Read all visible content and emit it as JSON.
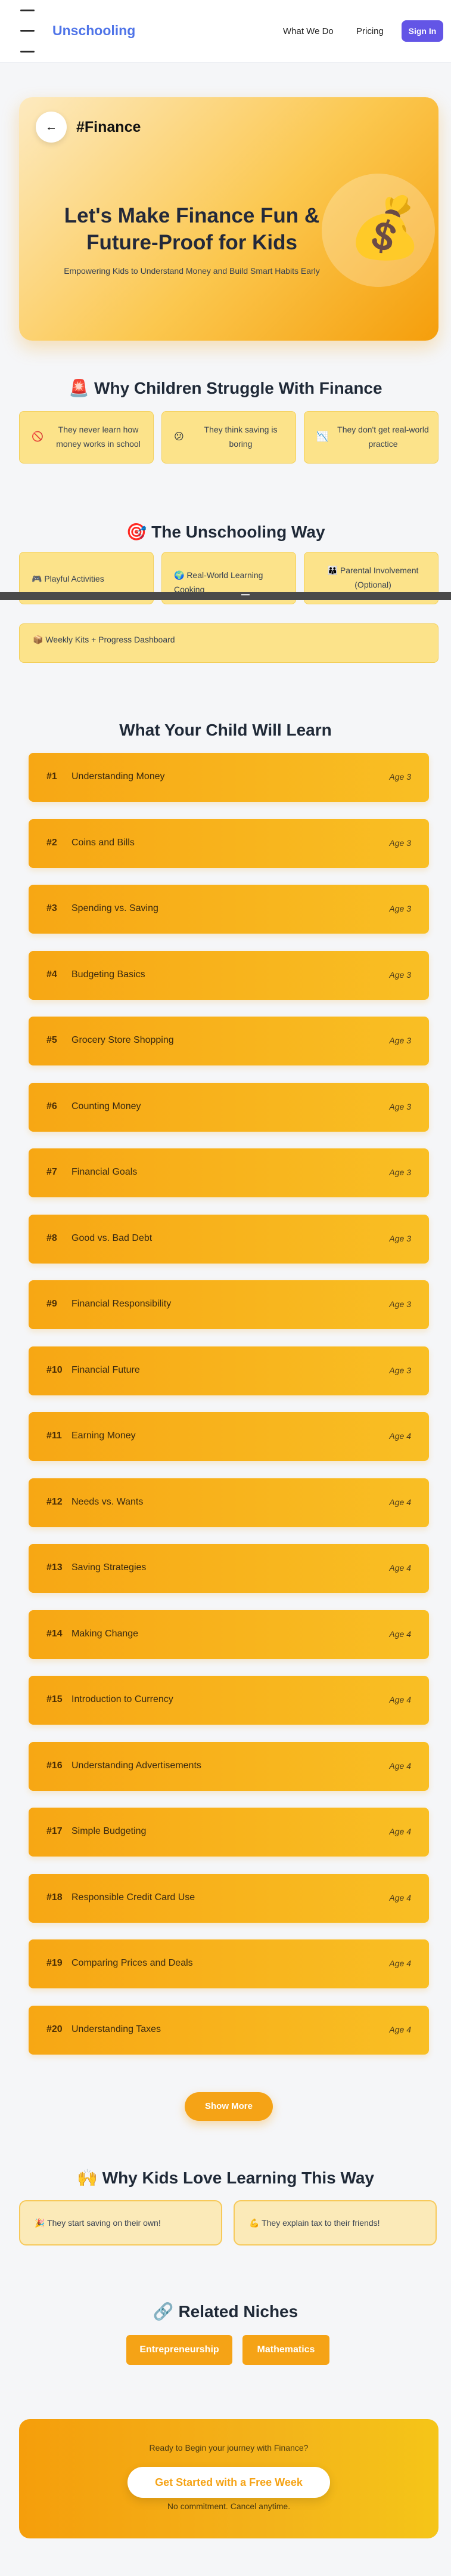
{
  "header": {
    "brand": "Unschooling",
    "nav": [
      "What We Do",
      "Pricing"
    ],
    "signin_label": "Sign In"
  },
  "hero": {
    "back_icon": "←",
    "hashtag": "#Finance",
    "title": "Let's Make Finance Fun & Future-Proof for Kids",
    "subtitle": "Empowering Kids to Understand Money and Build Smart Habits Early",
    "emoji": "💰"
  },
  "struggle": {
    "icon": "🚨",
    "title": "Why Children Struggle With Finance",
    "cards": [
      {
        "icon": "🚫",
        "text": "They never learn how money works in school"
      },
      {
        "icon": "😕",
        "text": "They think saving is boring"
      },
      {
        "icon": "📉",
        "text": "They don't get real-world practice"
      }
    ]
  },
  "way": {
    "icon": "🎯",
    "title": "The Unschooling Way",
    "cards": [
      {
        "text": "🎮 Playful Activities"
      },
      {
        "text": "🌍 Real-World Learning Cooking"
      },
      {
        "text": "👪 Parental Involvement (Optional)"
      },
      {
        "text": "📦 Weekly Kits + Progress Dashboard"
      }
    ]
  },
  "learn": {
    "title": "What Your Child Will Learn",
    "items": [
      {
        "num": "#1",
        "name": "Understanding Money",
        "age": "Age 3"
      },
      {
        "num": "#2",
        "name": "Coins and Bills",
        "age": "Age 3"
      },
      {
        "num": "#3",
        "name": "Spending vs. Saving",
        "age": "Age 3"
      },
      {
        "num": "#4",
        "name": "Budgeting Basics",
        "age": "Age 3"
      },
      {
        "num": "#5",
        "name": "Grocery Store Shopping",
        "age": "Age 3"
      },
      {
        "num": "#6",
        "name": "Counting Money",
        "age": "Age 3"
      },
      {
        "num": "#7",
        "name": "Financial Goals",
        "age": "Age 3"
      },
      {
        "num": "#8",
        "name": "Good vs. Bad Debt",
        "age": "Age 3"
      },
      {
        "num": "#9",
        "name": "Financial Responsibility",
        "age": "Age 3"
      },
      {
        "num": "#10",
        "name": "Financial Future",
        "age": "Age 3"
      },
      {
        "num": "#11",
        "name": "Earning Money",
        "age": "Age 4"
      },
      {
        "num": "#12",
        "name": "Needs vs. Wants",
        "age": "Age 4"
      },
      {
        "num": "#13",
        "name": "Saving Strategies",
        "age": "Age 4"
      },
      {
        "num": "#14",
        "name": "Making Change",
        "age": "Age 4"
      },
      {
        "num": "#15",
        "name": "Introduction to Currency",
        "age": "Age 4"
      },
      {
        "num": "#16",
        "name": "Understanding Advertisements",
        "age": "Age 4"
      },
      {
        "num": "#17",
        "name": "Simple Budgeting",
        "age": "Age 4"
      },
      {
        "num": "#18",
        "name": "Responsible Credit Card Use",
        "age": "Age 4"
      },
      {
        "num": "#19",
        "name": "Comparing Prices and Deals",
        "age": "Age 4"
      },
      {
        "num": "#20",
        "name": "Understanding Taxes",
        "age": "Age 4"
      }
    ],
    "show_more": "Show More"
  },
  "love": {
    "icon": "🙌",
    "title": "Why Kids Love Learning This Way",
    "cards": [
      {
        "text": "🎉 They start saving on their own!"
      },
      {
        "text": "💪 They explain tax to their friends!"
      }
    ]
  },
  "niches": {
    "icon": "🔗",
    "title": "Related Niches",
    "items": [
      "Entrepreneurship",
      "Mathematics"
    ]
  },
  "cta": {
    "ready": "Ready to Begin your journey with Finance?",
    "button": "Get Started with a Free Week",
    "note": "No commitment. Cancel anytime."
  }
}
